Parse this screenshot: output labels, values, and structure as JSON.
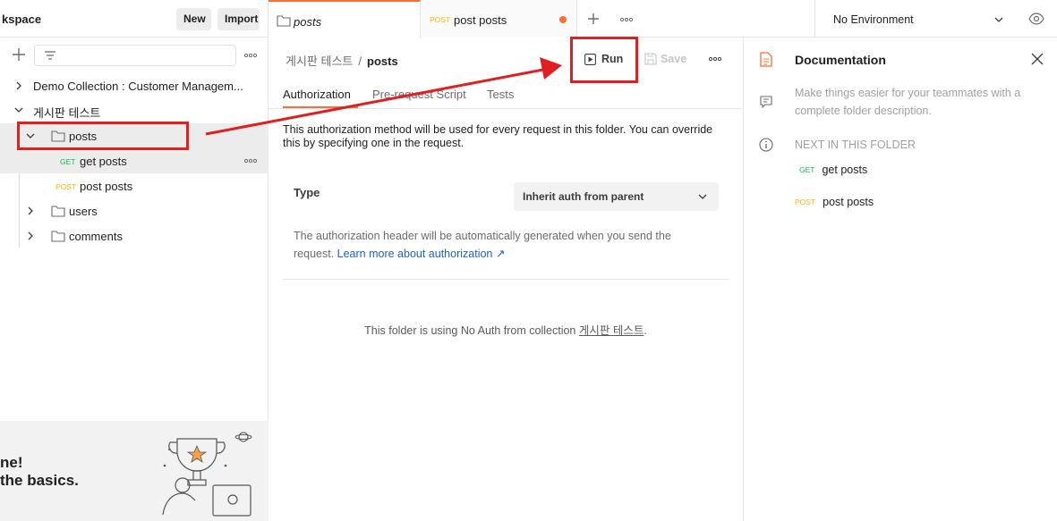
{
  "workspace": {
    "title": "kspace",
    "new_label": "New",
    "import_label": "Import"
  },
  "tree": {
    "items": [
      {
        "label": "Demo Collection : Customer Managem..."
      },
      {
        "label": "게시판 테스트"
      },
      {
        "label": "posts"
      },
      {
        "method": "GET",
        "label": "get posts"
      },
      {
        "method": "POST",
        "label": "post posts"
      },
      {
        "label": "users"
      },
      {
        "label": "comments"
      }
    ]
  },
  "promo": {
    "line1": "ne!",
    "line2": " the basics."
  },
  "tabs": [
    {
      "label": "posts"
    },
    {
      "method": "POST",
      "label": "post posts"
    }
  ],
  "environment": {
    "label": "No Environment"
  },
  "main": {
    "breadcrumb_parent": "게시판 테스트",
    "breadcrumb_sep": "/",
    "breadcrumb_current": "posts",
    "run_label": "Run",
    "save_label": "Save",
    "subtabs": [
      "Authorization",
      "Pre-request Script",
      "Tests"
    ],
    "description": "This authorization method will be used for every request in this folder. You can override this by specifying one in the request.",
    "type_label": "Type",
    "auth_type": "Inherit auth from parent",
    "auth_help": "The authorization header will be automatically generated when you send the request.",
    "learn_more": "Learn more about authorization ↗",
    "noauth_prefix": "This folder is using No Auth from collection ",
    "noauth_collection": "게시판 테스트",
    "noauth_suffix": "."
  },
  "documentation": {
    "title": "Documentation",
    "description": "Make things easier for your teammates with a complete folder description.",
    "next_title": "NEXT IN THIS FOLDER",
    "next_items": [
      {
        "method": "GET",
        "label": "get posts"
      },
      {
        "method": "POST",
        "label": "post posts"
      }
    ]
  },
  "colors": {
    "accent": "#ff6c37",
    "get": "#0cbb52",
    "post": "#ffb400",
    "annotation": "#e02020",
    "link": "#1d62c9"
  }
}
